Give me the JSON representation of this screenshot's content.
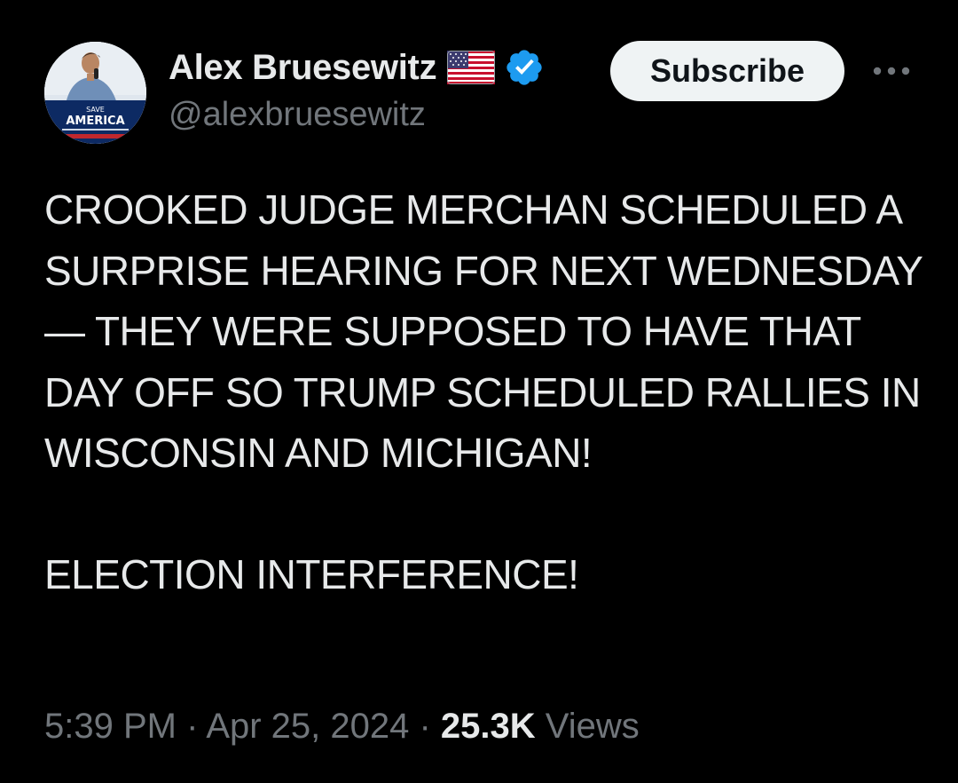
{
  "author": {
    "display_name": "Alex Bruesewitz",
    "handle": "@alexbruesewitz",
    "avatar_sign_text": {
      "line1": "SAVE",
      "line2": "AMERICA"
    }
  },
  "badges": {
    "flag_icon": "us-flag-icon",
    "verified_icon": "verified-badge-icon",
    "verified_color": "#1d9bf0"
  },
  "actions": {
    "subscribe_label": "Subscribe",
    "more_icon": "more-icon"
  },
  "tweet": {
    "paragraph1": "CROOKED JUDGE MERCHAN SCHEDULED A SURPRISE HEARING FOR NEXT WEDNESDAY — THEY WERE SUPPOSED TO HAVE THAT DAY OFF SO TRUMP SCHEDULED RALLIES IN WISCONSIN AND MICHIGAN!",
    "paragraph2": "ELECTION INTERFERENCE!"
  },
  "meta": {
    "time": "5:39 PM",
    "separator": " · ",
    "date": "Apr 25, 2024",
    "views_count": "25.3K",
    "views_label": " Views"
  },
  "colors": {
    "background": "#000000",
    "primary_text": "#e7e9ea",
    "secondary_text": "#71767b",
    "button_bg": "#eff3f4",
    "button_text": "#0f1419"
  }
}
